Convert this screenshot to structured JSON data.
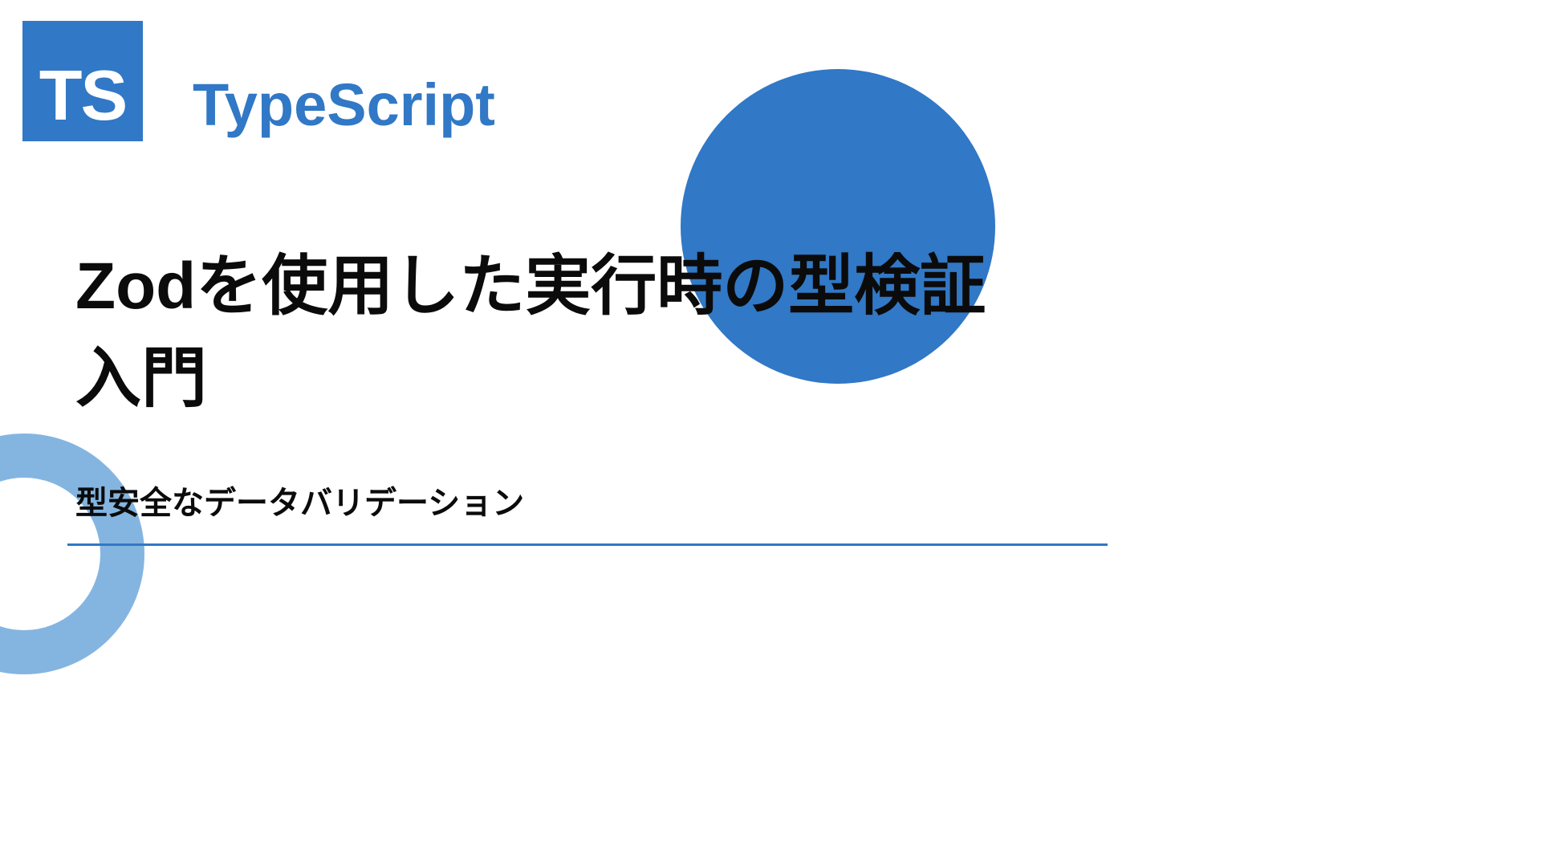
{
  "logo": {
    "text": "TS"
  },
  "header": {
    "label": "TypeScript"
  },
  "title": "Zodを使用した実行時の型検証入門",
  "subtitle": "型安全なデータバリデーション",
  "colors": {
    "brand": "#3178c6",
    "accent_light": "#6fa8dc"
  }
}
